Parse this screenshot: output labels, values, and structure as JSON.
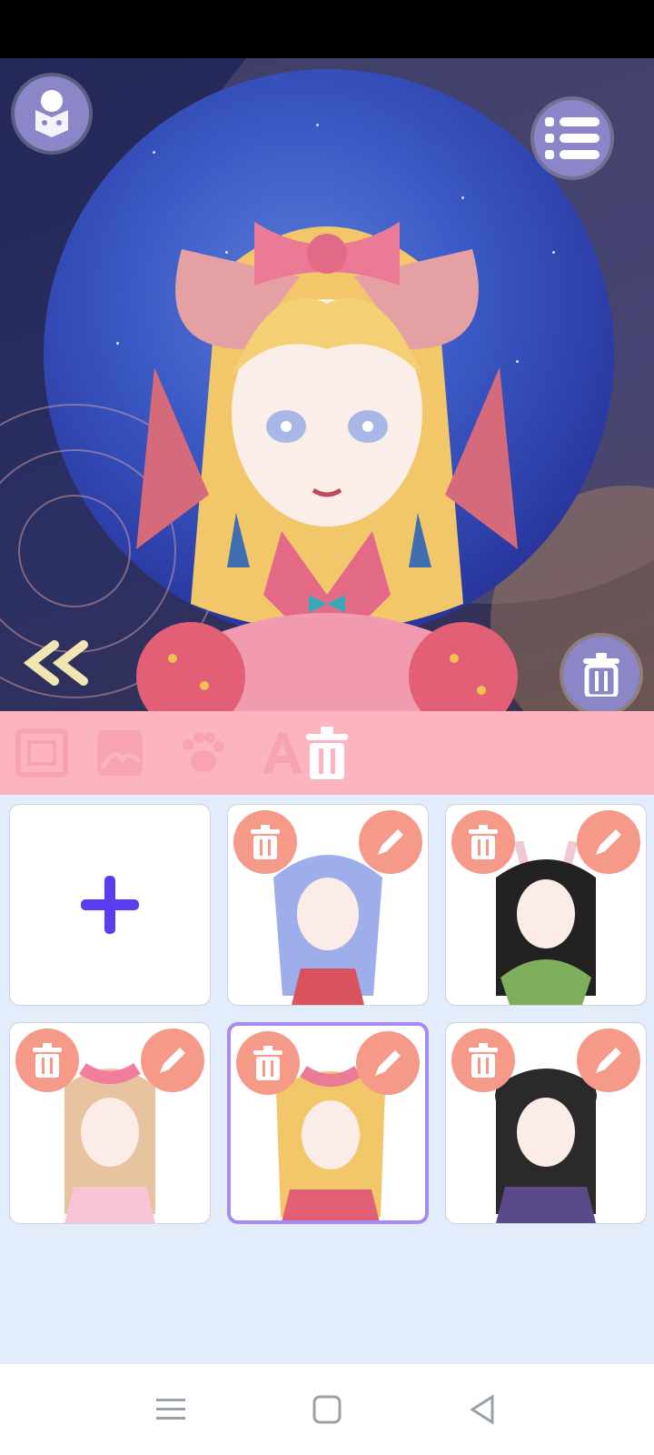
{
  "toolbar": {
    "cube_icon": "cube-dice-icon",
    "menu_icon": "list-menu-icon",
    "delete_icon": "trash-icon",
    "back_icon": "double-chevron-left-icon"
  },
  "tabs": [
    {
      "icon": "frame-icon"
    },
    {
      "icon": "background-icon"
    },
    {
      "icon": "paw-icon"
    },
    {
      "icon": "text-a-icon"
    },
    {
      "icon": "trash-icon",
      "active": true
    }
  ],
  "gallery": {
    "add_icon": "plus-icon",
    "cards": [
      {
        "type": "add"
      },
      {
        "type": "character",
        "theme": "lavender-butterfly"
      },
      {
        "type": "character",
        "theme": "bunny-ears-black-hair"
      },
      {
        "type": "character",
        "theme": "pink-bow-blonde-mask"
      },
      {
        "type": "character",
        "theme": "strawberry-blonde",
        "selected": true
      },
      {
        "type": "character",
        "theme": "dark-gothic"
      }
    ]
  },
  "colors": {
    "accent_purple": "#5b3df0",
    "card_button": "#f59a88",
    "tabbar": "#fbb4c0",
    "selected_border": "#a78bf0"
  }
}
